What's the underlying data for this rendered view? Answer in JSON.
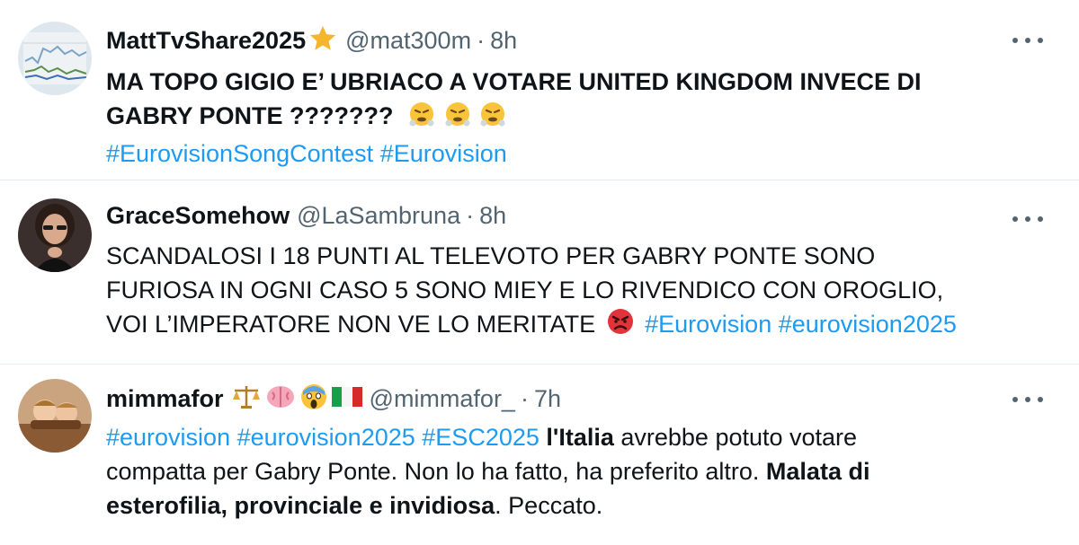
{
  "tweets": [
    {
      "name": "MattTvShare2025",
      "handle": "@mat300m",
      "separator": "·",
      "time": "8h",
      "lines": [
        "MA TOPO GIGIO E’ UBRIACO A VOTARE UNITED KINGDOM INVECE DI",
        "GABRY PONTE ???????"
      ],
      "hashtags": [
        "#EurovisionSongContest",
        "#Eurovision"
      ]
    },
    {
      "name": "GraceSomehow",
      "handle": "@LaSambruna",
      "separator": "·",
      "time": "8h",
      "lines": [
        "SCANDALOSI I 18 PUNTI AL TELEVOTO PER GABRY PONTE SONO",
        "FURIOSA IN OGNI CASO 5 SONO MIEY E LO RIVENDICO CON OROGLIO,",
        "VOI L’IMPERATORE NON VE LO MERITATE"
      ],
      "hashtags": [
        "#Eurovision",
        "#eurovision2025"
      ]
    },
    {
      "name": "mimmafor",
      "handle": "@mimmafor_",
      "separator": "·",
      "time": "7h",
      "hashtags": [
        "#eurovision",
        "#eurovision2025",
        "#ESC2025"
      ],
      "text_bold_1": "l'Italia",
      "text_1": "avrebbe potuto votare",
      "text_2": "compatta per Gabry Ponte. Non lo ha fatto, ha preferito altro.",
      "text_bold_2": "Malata di",
      "text_bold_3": "esterofilia, provinciale e invidiosa",
      "text_3": ". Peccato."
    }
  ],
  "colors": {
    "accent": "#1d9bf0",
    "muted": "#536471",
    "text": "#0f1419",
    "divider": "#e6ecf0"
  },
  "icons": [
    "star-emoji",
    "steam-from-nose-emoji",
    "pouting-face-emoji",
    "balance-scale-emoji",
    "brain-emoji",
    "screaming-face-emoji",
    "italy-flag-emoji",
    "more-options-icon"
  ]
}
